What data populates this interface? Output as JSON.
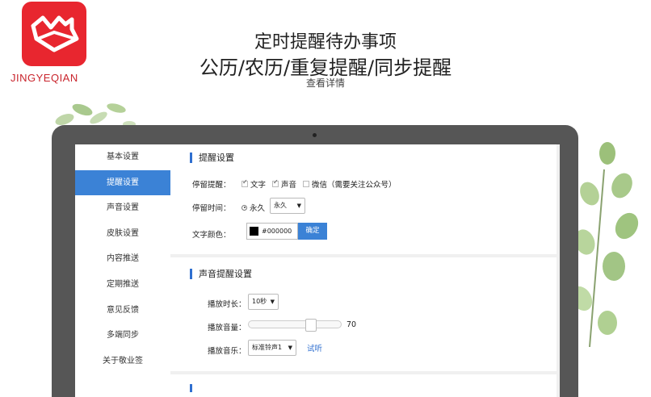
{
  "brand": {
    "name": "JINGYEQIAN",
    "color": "#e8262f"
  },
  "headline": {
    "line1": "定时提醒待办事项",
    "line2": "公历/农历/重复提醒/同步提醒",
    "details_link": "查看详情"
  },
  "sidebar": {
    "items": [
      {
        "label": "基本设置",
        "active": false
      },
      {
        "label": "提醒设置",
        "active": true
      },
      {
        "label": "声音设置",
        "active": false
      },
      {
        "label": "皮肤设置",
        "active": false
      },
      {
        "label": "内容推送",
        "active": false
      },
      {
        "label": "定期推送",
        "active": false
      },
      {
        "label": "意见反馈",
        "active": false
      },
      {
        "label": "多端同步",
        "active": false
      },
      {
        "label": "关于敬业签",
        "active": false
      }
    ]
  },
  "reminder": {
    "title": "提醒设置",
    "stay_label": "停留提醒：",
    "opt_text": "文字",
    "opt_text_checked": true,
    "opt_sound": "声音",
    "opt_sound_checked": true,
    "opt_wechat": "微信（需要关注公众号）",
    "opt_wechat_checked": false,
    "time_label": "停留时间：",
    "time_radio": "永久",
    "time_select": "永久",
    "color_label": "文字颜色：",
    "color_value": "#000000",
    "confirm": "确定"
  },
  "sound": {
    "title": "声音提醒设置",
    "duration_label": "播放时长：",
    "duration_value": "10秒",
    "volume_label": "播放音量：",
    "volume_value": "70",
    "volume_fraction": 0.7,
    "music_label": "播放音乐：",
    "music_value": "标准铃声1",
    "test_link": "试听"
  },
  "colors": {
    "accent": "#3b82d6",
    "frame": "#565656"
  }
}
